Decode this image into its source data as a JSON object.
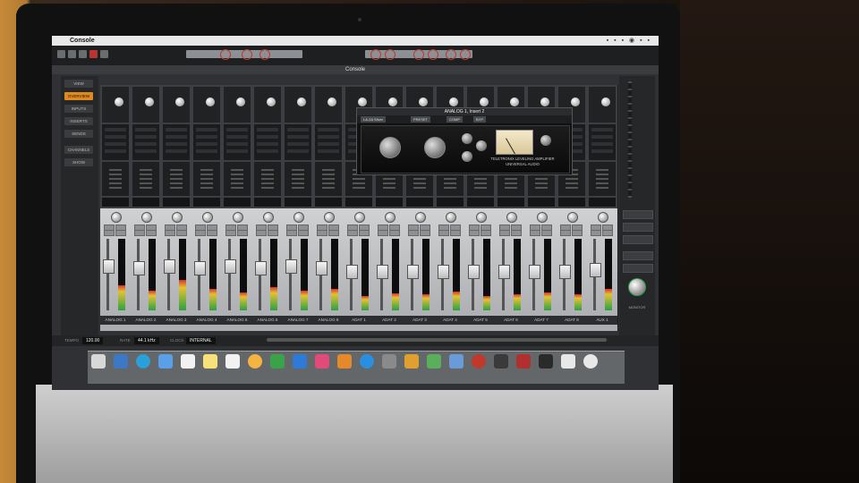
{
  "window": {
    "menubar_title": "Console",
    "title": "Console"
  },
  "left_panel": {
    "items": [
      "VIEW",
      "OVERVIEW",
      "INPUTS",
      "INSERTS",
      "SENDS",
      "CHANNELS",
      "SHOW"
    ]
  },
  "plugin_window": {
    "title": "ANALOG 1, Insert 2",
    "buttons": [
      "LA-2A Silver",
      "PRESET",
      "COMP",
      "BYP"
    ],
    "brand": "TELETRONIX LEVELING AMPLIFIER",
    "maker": "UNIVERSAL AUDIO"
  },
  "channels": [
    "ANALOG 1",
    "ANALOG 2",
    "ANALOG 3",
    "ANALOG 4",
    "ANALOG 5",
    "ANALOG 6",
    "ANALOG 7",
    "ANALOG 8",
    "ADAT 1",
    "ADAT 2",
    "ADAT 3",
    "ADAT 4",
    "ADAT 5",
    "ADAT 6",
    "ADAT 7",
    "ADAT 8",
    "AUX 1"
  ],
  "channel_meter_levels": [
    0.35,
    0.28,
    0.42,
    0.3,
    0.25,
    0.32,
    0.28,
    0.3,
    0.2,
    0.24,
    0.22,
    0.26,
    0.2,
    0.23,
    0.25,
    0.22,
    0.3
  ],
  "channel_fader_levels": [
    0.62,
    0.6,
    0.62,
    0.6,
    0.62,
    0.6,
    0.62,
    0.6,
    0.55,
    0.55,
    0.55,
    0.55,
    0.55,
    0.55,
    0.55,
    0.55,
    0.58
  ],
  "right_panel": {
    "buttons": [
      "CUE",
      "SOLO",
      "MUTE"
    ],
    "monitor_label": "MONITOR"
  },
  "status_bar": {
    "tempo_label": "TEMPO",
    "tempo_value": "120.00",
    "rate_label": "RATE",
    "rate_value": "44.1 kHz",
    "clock_label": "CLOCK",
    "clock_value": "INTERNAL"
  },
  "dock": {
    "icons": [
      "finder-icon",
      "launchpad-icon",
      "safari-icon",
      "mail-icon",
      "calendar-icon",
      "notes-icon",
      "reminders-icon",
      "photos-icon",
      "numbers-icon",
      "keynote-icon",
      "itunes-icon",
      "ibooks-icon",
      "app-store-icon",
      "system-preferences-icon",
      "game-icon",
      "maps-icon",
      "preview-icon",
      "app-icon",
      "uad-meter-icon",
      "rx-icon",
      "console-icon",
      "uad-icon",
      "trash-icon"
    ]
  },
  "colors": {
    "accent": "#e08a1e",
    "meter_green": "#2ea043",
    "meter_yellow": "#e2c234",
    "meter_red": "#d9342b",
    "record_red": "#c0392b"
  }
}
